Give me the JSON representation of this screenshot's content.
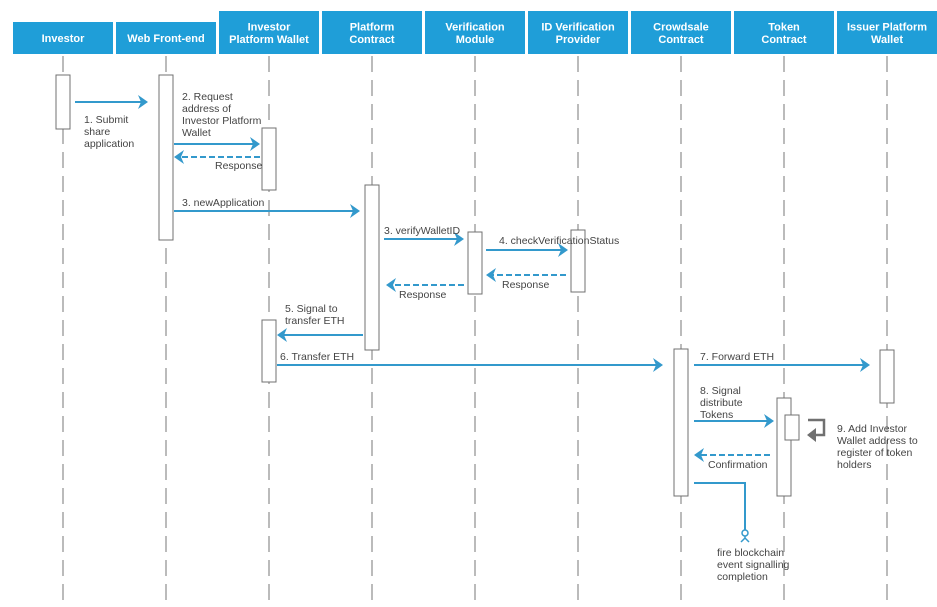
{
  "colors": {
    "header_bg": "#1f9ed8",
    "header_text": "#ffffff",
    "message": "#3399cc",
    "lifeline": "#777777",
    "self_call": "#707070",
    "label": "#444444"
  },
  "participants": [
    {
      "id": "investor",
      "lines": [
        "Investor"
      ]
    },
    {
      "id": "web-front-end",
      "lines": [
        "Web Front-end"
      ]
    },
    {
      "id": "investor-platform-wallet",
      "lines": [
        "Investor",
        "Platform Wallet"
      ]
    },
    {
      "id": "platform-contract",
      "lines": [
        "Platform",
        "Contract"
      ]
    },
    {
      "id": "verification-module",
      "lines": [
        "Verification",
        "Module"
      ]
    },
    {
      "id": "id-verification-provider",
      "lines": [
        "ID Verification",
        "Provider"
      ]
    },
    {
      "id": "crowdsale-contract",
      "lines": [
        "Crowdsale",
        "Contract"
      ]
    },
    {
      "id": "token-contract",
      "lines": [
        "Token",
        "Contract"
      ]
    },
    {
      "id": "issuer-platform-wallet",
      "lines": [
        "Issuer Platform",
        "Wallet"
      ]
    }
  ],
  "messages": [
    {
      "id": "submit-share-application",
      "from": 0,
      "to": 1,
      "type": "sync",
      "label_lines": [
        "1. Submit",
        "share",
        "application"
      ]
    },
    {
      "id": "request-address",
      "from": 1,
      "to": 2,
      "type": "sync",
      "label_lines": [
        "2. Request",
        "address of",
        "Investor Platform",
        "Wallet"
      ]
    },
    {
      "id": "response-wallet",
      "from": 2,
      "to": 1,
      "type": "return",
      "label_lines": [
        "Response"
      ]
    },
    {
      "id": "new-application",
      "from": 1,
      "to": 3,
      "type": "sync",
      "label_lines": [
        "3. newApplication"
      ]
    },
    {
      "id": "verify-wallet-id",
      "from": 3,
      "to": 4,
      "type": "sync",
      "label_lines": [
        "3. verifyWalletID"
      ]
    },
    {
      "id": "check-verification-status",
      "from": 4,
      "to": 5,
      "type": "sync",
      "label_lines": [
        "4. checkVerificationStatus"
      ]
    },
    {
      "id": "response-provider",
      "from": 5,
      "to": 4,
      "type": "return",
      "label_lines": [
        "Response"
      ]
    },
    {
      "id": "response-module",
      "from": 4,
      "to": 3,
      "type": "return",
      "label_lines": [
        "Response"
      ]
    },
    {
      "id": "signal-transfer-eth",
      "from": 3,
      "to": 2,
      "type": "sync",
      "label_lines": [
        "5. Signal to",
        "transfer ETH"
      ]
    },
    {
      "id": "transfer-eth",
      "from": 2,
      "to": 6,
      "type": "sync",
      "label_lines": [
        "6. Transfer ETH"
      ]
    },
    {
      "id": "forward-eth",
      "from": 6,
      "to": 8,
      "type": "sync",
      "label_lines": [
        "7. Forward ETH"
      ]
    },
    {
      "id": "signal-distribute-tokens",
      "from": 6,
      "to": 7,
      "type": "sync",
      "label_lines": [
        "8. Signal",
        "distribute",
        "Tokens"
      ]
    },
    {
      "id": "add-investor-wallet",
      "from": 7,
      "to": 7,
      "type": "self",
      "label_lines": [
        "9. Add Investor",
        "Wallet address to",
        "register of token",
        "holders"
      ]
    },
    {
      "id": "confirmation",
      "from": 7,
      "to": 6,
      "type": "return",
      "label_lines": [
        "Confirmation"
      ]
    },
    {
      "id": "fire-event",
      "from": 6,
      "to": null,
      "type": "event",
      "label_lines": [
        "fire blockchain",
        "event signalling",
        "completion"
      ]
    }
  ]
}
